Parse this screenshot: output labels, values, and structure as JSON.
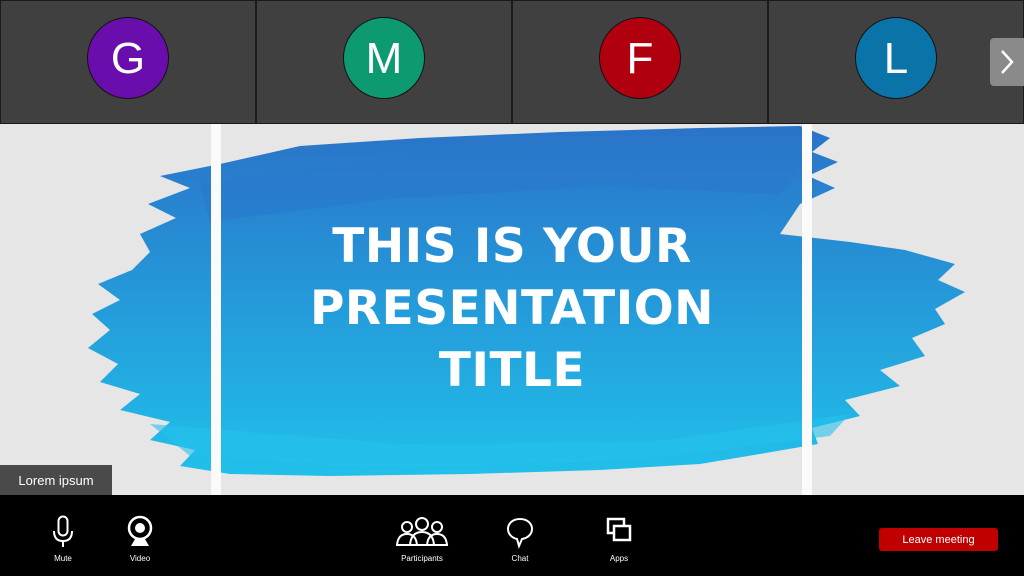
{
  "participants": [
    {
      "initial": "G",
      "color": "#6a0dad"
    },
    {
      "initial": "M",
      "color": "#0d9a70"
    },
    {
      "initial": "F",
      "color": "#b00010"
    },
    {
      "initial": "L",
      "color": "#0a73a8"
    }
  ],
  "slide": {
    "title_lines": [
      "THIS IS YOUR",
      "PRESENTATION",
      "TITLE"
    ],
    "brush_colors": [
      "#2a73c8",
      "#21b9e6"
    ]
  },
  "name_tag": "Lorem ipsum",
  "toolbar": {
    "mute_label": "Mute",
    "video_label": "Video",
    "participants_label": "Participants",
    "chat_label": "Chat",
    "apps_label": "Apps",
    "leave_label": "Leave meeting",
    "leave_color": "#c00000"
  }
}
